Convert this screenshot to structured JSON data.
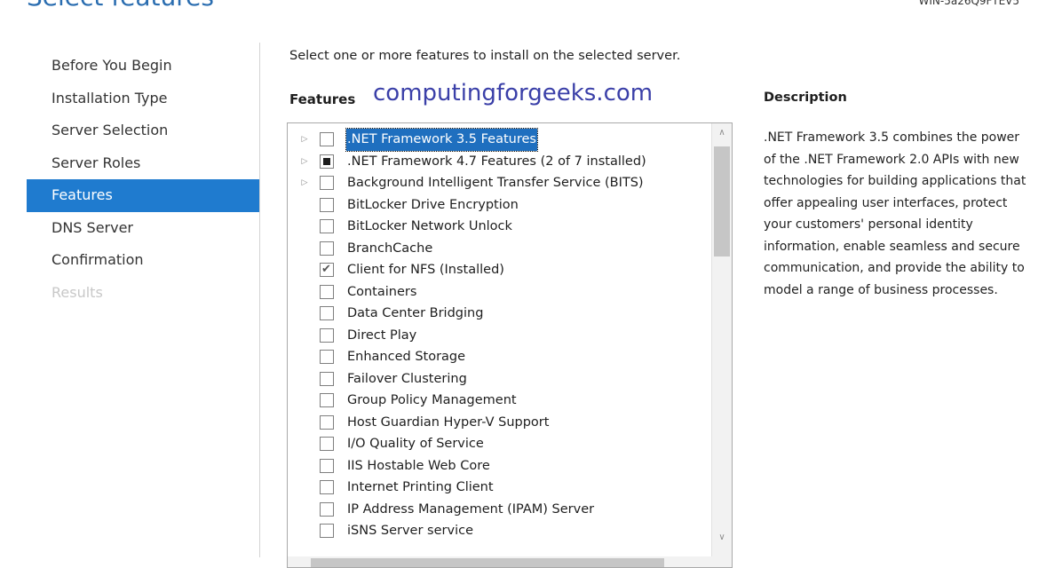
{
  "page_title": "Select features",
  "server_name": "WIN-5a26Q9FTEV5",
  "nav": {
    "items": [
      {
        "label": "Before You Begin",
        "state": "normal"
      },
      {
        "label": "Installation Type",
        "state": "normal"
      },
      {
        "label": "Server Selection",
        "state": "normal"
      },
      {
        "label": "Server Roles",
        "state": "normal"
      },
      {
        "label": "Features",
        "state": "active"
      },
      {
        "label": "DNS Server",
        "state": "normal"
      },
      {
        "label": "Confirmation",
        "state": "normal"
      },
      {
        "label": "Results",
        "state": "disabled"
      }
    ]
  },
  "instruction": "Select one or more features to install on the selected server.",
  "features_label": "Features",
  "watermark": "computingforgeeks.com",
  "features": [
    {
      "label": ".NET Framework 3.5 Features",
      "expandable": true,
      "state": "unchecked",
      "selected": true
    },
    {
      "label": ".NET Framework 4.7 Features (2 of 7 installed)",
      "expandable": true,
      "state": "partial",
      "selected": false
    },
    {
      "label": "Background Intelligent Transfer Service (BITS)",
      "expandable": true,
      "state": "unchecked",
      "selected": false
    },
    {
      "label": "BitLocker Drive Encryption",
      "expandable": false,
      "state": "unchecked",
      "selected": false
    },
    {
      "label": "BitLocker Network Unlock",
      "expandable": false,
      "state": "unchecked",
      "selected": false
    },
    {
      "label": "BranchCache",
      "expandable": false,
      "state": "unchecked",
      "selected": false
    },
    {
      "label": "Client for NFS (Installed)",
      "expandable": false,
      "state": "checked",
      "selected": false
    },
    {
      "label": "Containers",
      "expandable": false,
      "state": "unchecked",
      "selected": false
    },
    {
      "label": "Data Center Bridging",
      "expandable": false,
      "state": "unchecked",
      "selected": false
    },
    {
      "label": "Direct Play",
      "expandable": false,
      "state": "unchecked",
      "selected": false
    },
    {
      "label": "Enhanced Storage",
      "expandable": false,
      "state": "unchecked",
      "selected": false
    },
    {
      "label": "Failover Clustering",
      "expandable": false,
      "state": "unchecked",
      "selected": false
    },
    {
      "label": "Group Policy Management",
      "expandable": false,
      "state": "unchecked",
      "selected": false
    },
    {
      "label": "Host Guardian Hyper-V Support",
      "expandable": false,
      "state": "unchecked",
      "selected": false
    },
    {
      "label": "I/O Quality of Service",
      "expandable": false,
      "state": "unchecked",
      "selected": false
    },
    {
      "label": "IIS Hostable Web Core",
      "expandable": false,
      "state": "unchecked",
      "selected": false
    },
    {
      "label": "Internet Printing Client",
      "expandable": false,
      "state": "unchecked",
      "selected": false
    },
    {
      "label": "IP Address Management (IPAM) Server",
      "expandable": false,
      "state": "unchecked",
      "selected": false
    },
    {
      "label": "iSNS Server service",
      "expandable": false,
      "state": "unchecked",
      "selected": false
    }
  ],
  "description": {
    "title": "Description",
    "text": ".NET Framework 3.5 combines the power of the .NET Framework 2.0 APIs with new technologies for building applications that offer appealing user interfaces, protect your customers' personal identity information, enable seamless and secure communication, and provide the ability to model a range of business processes."
  },
  "colors": {
    "accent": "#1f7bcf",
    "title": "#2a6db0",
    "watermark": "#3a3fa8"
  }
}
